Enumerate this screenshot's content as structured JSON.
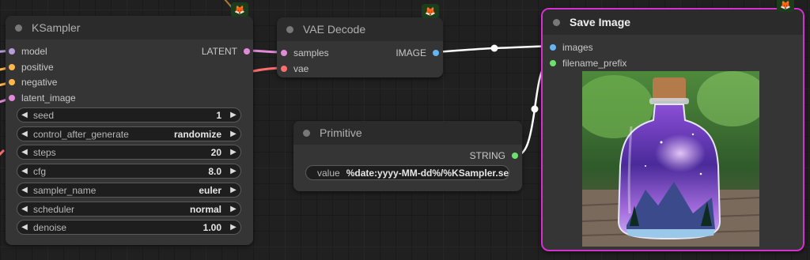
{
  "colors": {
    "latent": "#e08ad8",
    "model": "#b39ddb",
    "clip": "#ffb74d",
    "image": "#64b5f6",
    "vae": "#ff6e6e",
    "string": "#6be36b",
    "selected": "#d630d0"
  },
  "badge_icon": "fox-icon",
  "ksampler": {
    "title": "KSampler",
    "inputs": [
      {
        "label": "model",
        "type": "model"
      },
      {
        "label": "positive",
        "type": "clip"
      },
      {
        "label": "negative",
        "type": "clip"
      },
      {
        "label": "latent_image",
        "type": "latent"
      }
    ],
    "output": "LATENT",
    "widgets": [
      {
        "label": "seed",
        "value": "1"
      },
      {
        "label": "control_after_generate",
        "value": "randomize"
      },
      {
        "label": "steps",
        "value": "20"
      },
      {
        "label": "cfg",
        "value": "8.0"
      },
      {
        "label": "sampler_name",
        "value": "euler"
      },
      {
        "label": "scheduler",
        "value": "normal"
      },
      {
        "label": "denoise",
        "value": "1.00"
      }
    ]
  },
  "vae_decode": {
    "title": "VAE Decode",
    "inputs": [
      {
        "label": "samples",
        "type": "latent"
      },
      {
        "label": "vae",
        "type": "vae"
      }
    ],
    "output": "IMAGE"
  },
  "primitive": {
    "title": "Primitive",
    "output": "STRING",
    "widget": {
      "label": "value",
      "value": "%date:yyyy-MM-dd%/%KSampler.se"
    }
  },
  "save_image": {
    "title": "Save Image",
    "inputs": [
      {
        "label": "images",
        "type": "image"
      },
      {
        "label": "filename_prefix",
        "type": "string"
      }
    ],
    "preview": "bottle-galaxy-preview-image"
  }
}
